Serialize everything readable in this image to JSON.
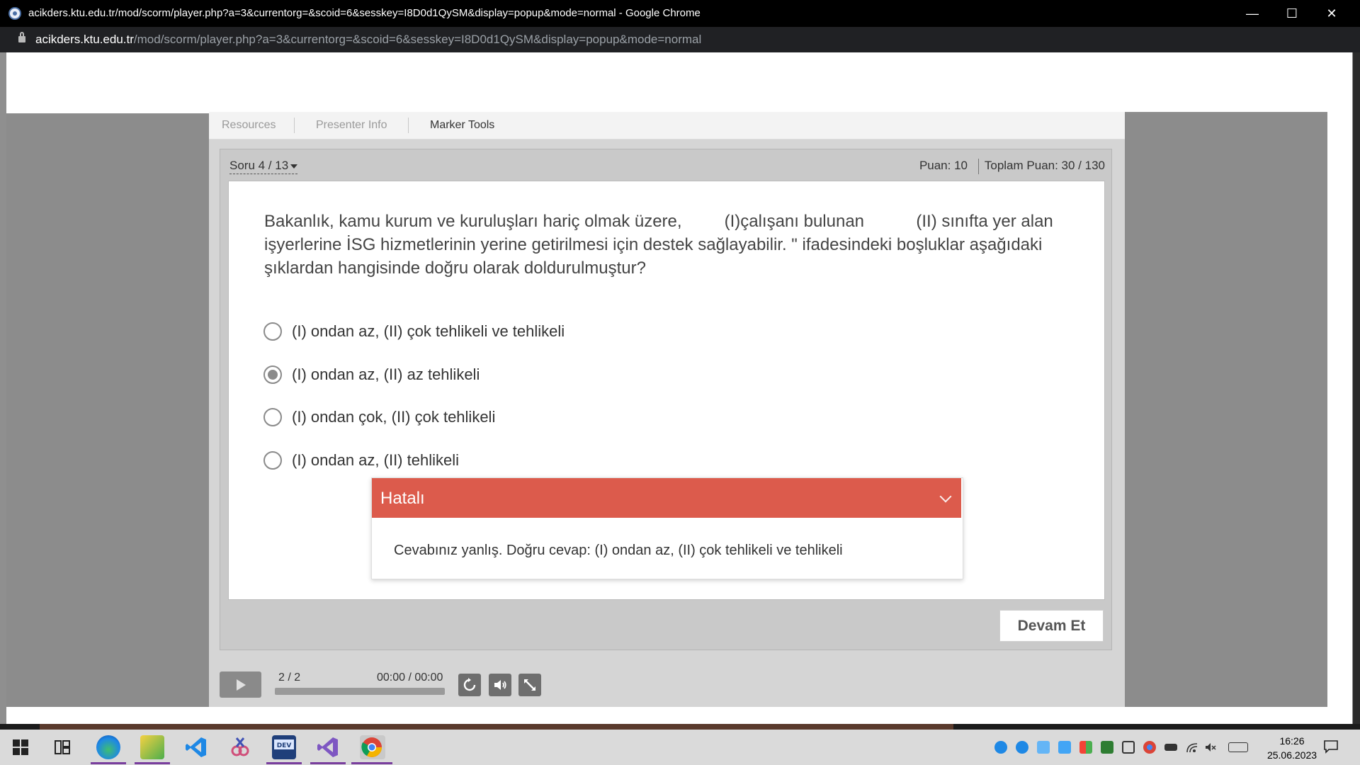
{
  "window": {
    "title": "acikders.ktu.edu.tr/mod/scorm/player.php?a=3&currentorg=&scoid=6&sesskey=I8D0d1QySM&display=popup&mode=normal - Google Chrome",
    "url_host": "acikders.ktu.edu.tr",
    "url_path": "/mod/scorm/player.php?a=3&currentorg=&scoid=6&sesskey=I8D0d1QySM&display=popup&mode=normal"
  },
  "tabs": [
    "Resources",
    "Presenter Info",
    "Marker Tools"
  ],
  "quiz": {
    "question_nav": "Soru 4 / 13",
    "score": "Puan: 10",
    "total_score": "Toplam Puan: 30 / 130",
    "question_text": "Bakanlık, kamu kurum ve kuruluşları hariç olmak üzere,         (I)çalışanı bulunan           (II) sınıfta yer alan işyerlerine İSG hizmetlerinin yerine getirilmesi için destek sağlayabilir. \" ifadesindeki boşluklar aşağıdaki şıklardan hangisinde doğru olarak doldurulmuştur?",
    "options": [
      {
        "label": "(I) ondan az, (II) çok tehlikeli ve tehlikeli",
        "selected": false
      },
      {
        "label": "(I) ondan az, (II) az tehlikeli",
        "selected": true
      },
      {
        "label": "(I) ondan çok, (II) çok tehlikeli",
        "selected": false
      },
      {
        "label": "(I) ondan az, (II) tehlikeli",
        "selected": false
      }
    ],
    "feedback_title": "Hatalı",
    "feedback_text": "Cevabınız yanlış. Doğru cevap: (I) ondan az, (II) çok tehlikeli ve tehlikeli",
    "continue_label": "Devam Et"
  },
  "player": {
    "slide_count": "2 / 2",
    "timer": "00:00 / 00:00"
  },
  "taskbar": {
    "time": "16:26",
    "date": "25.06.2023"
  },
  "colors": {
    "feedback_error": "#dc5b4c",
    "background_gray": "#8c8c8c"
  }
}
